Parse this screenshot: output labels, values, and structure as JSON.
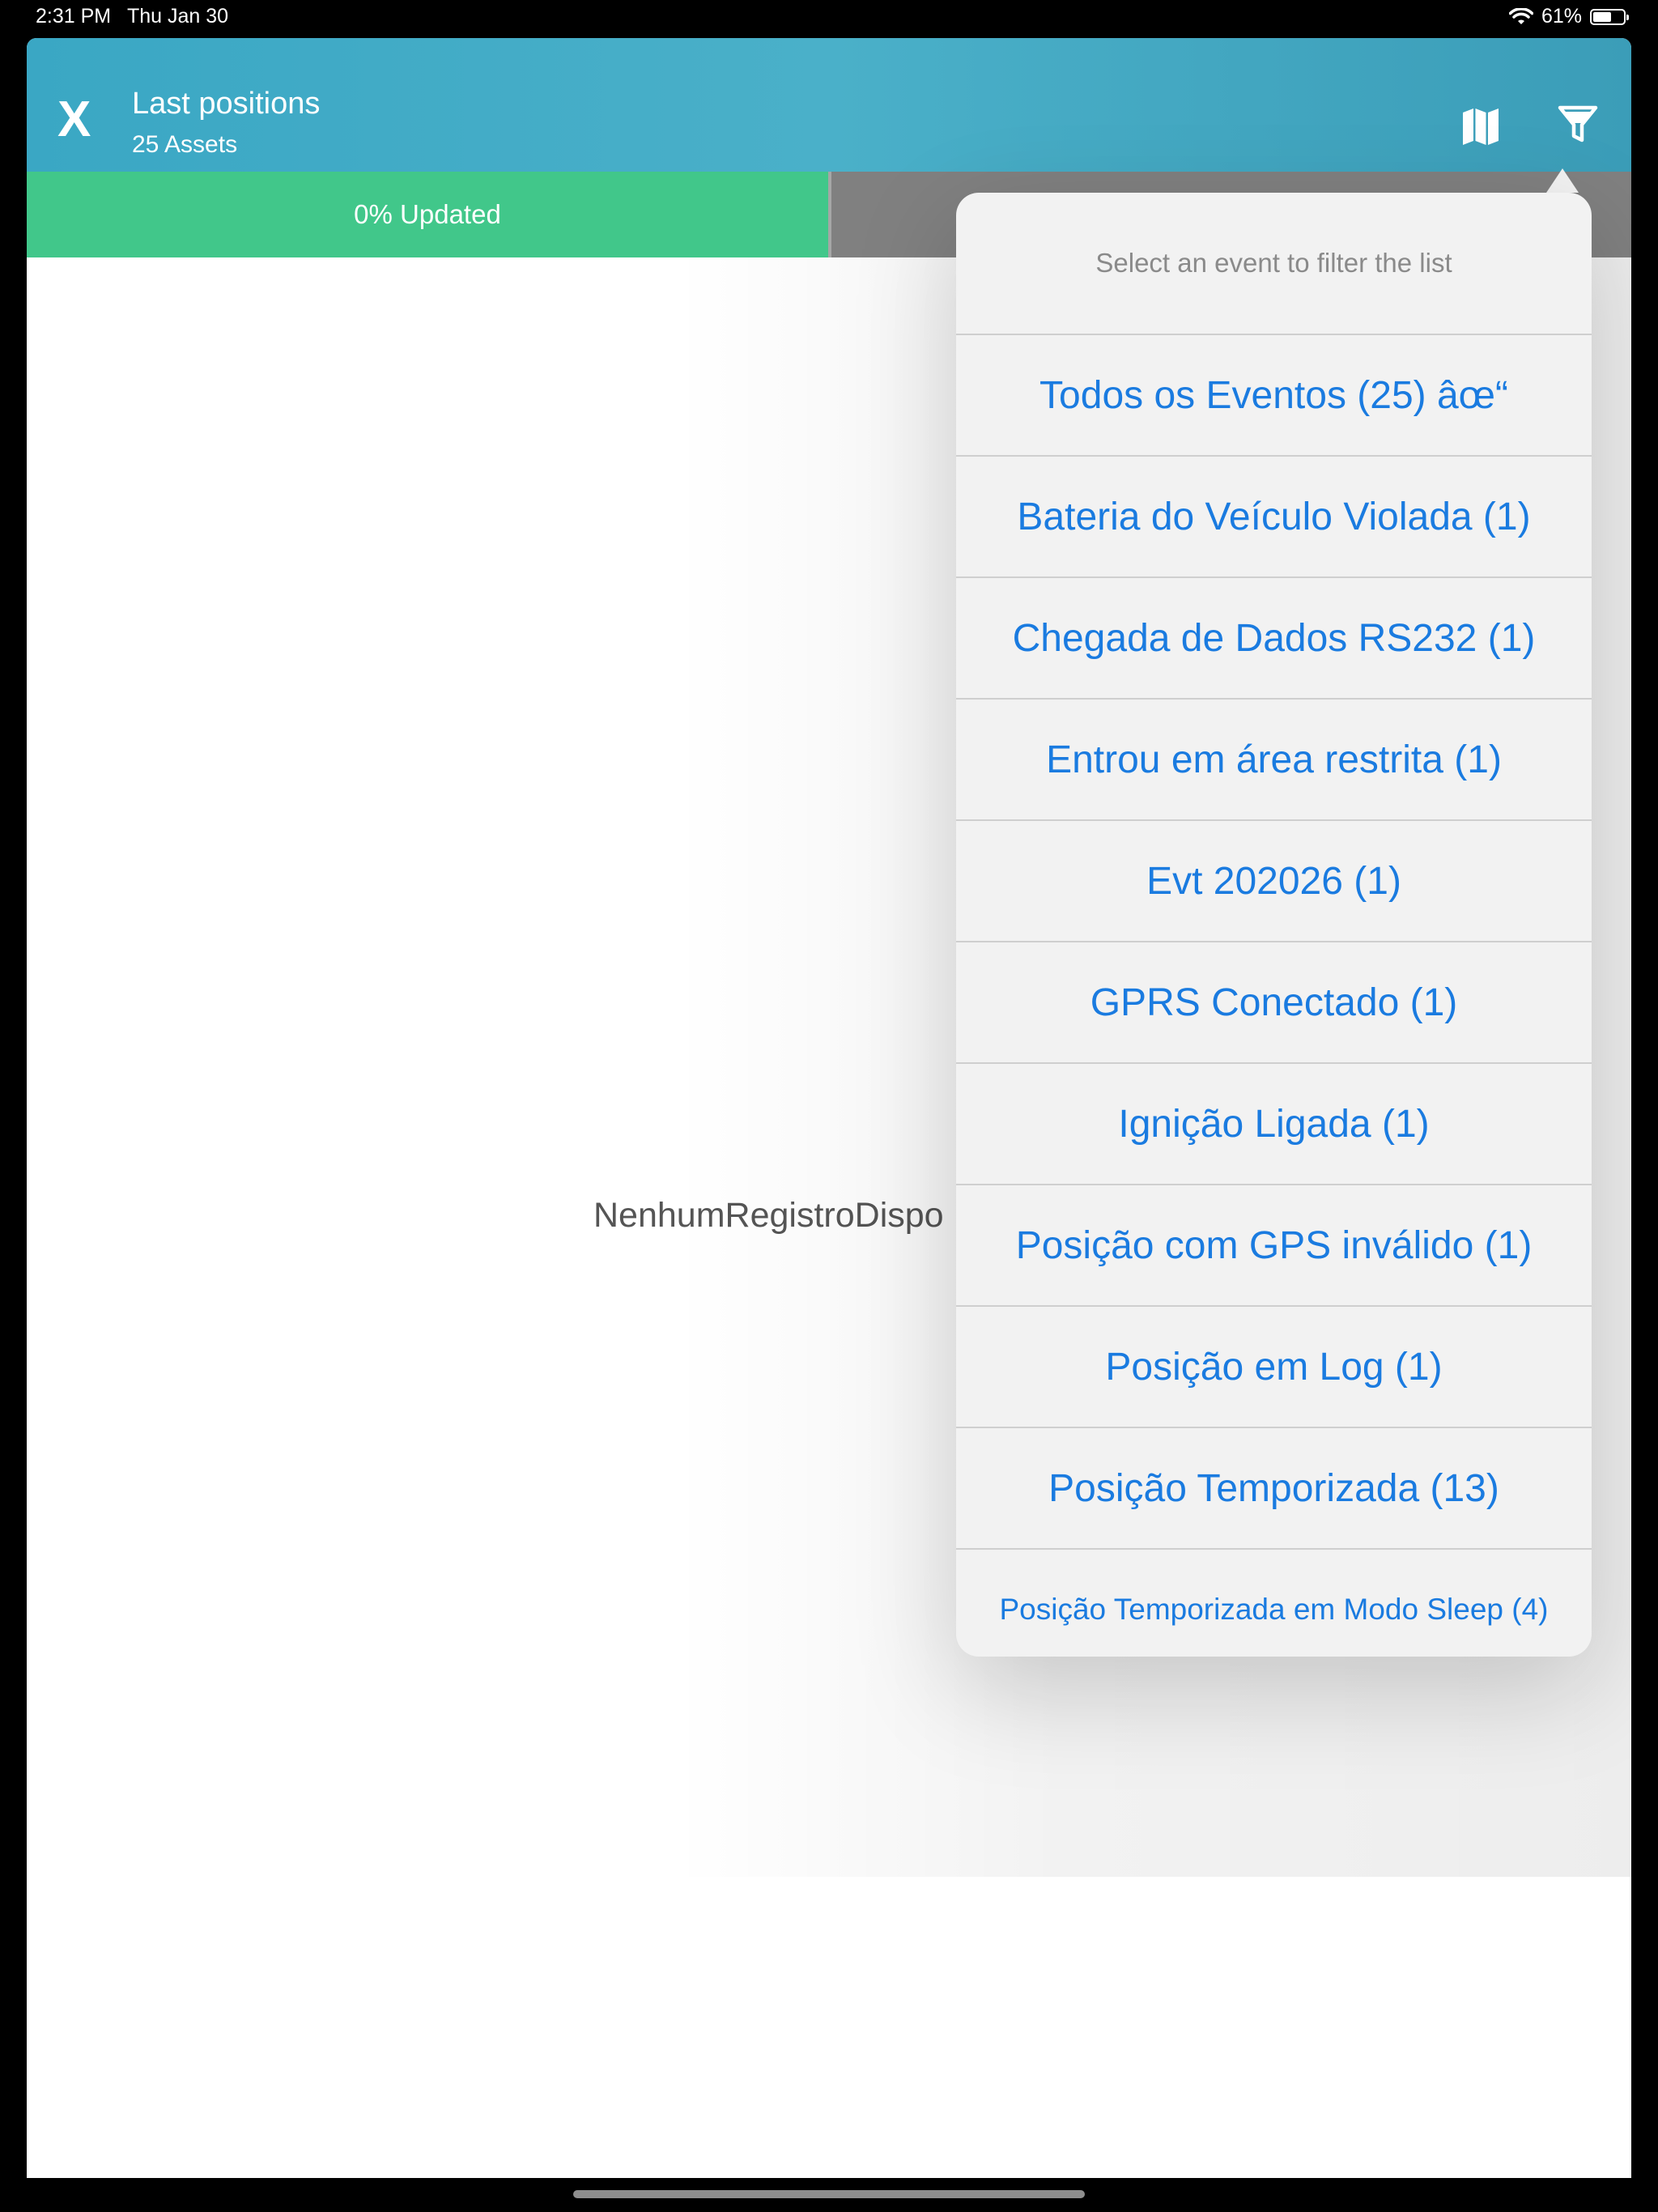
{
  "status_bar": {
    "time": "2:31 PM",
    "date": "Thu Jan 30",
    "battery": "61%"
  },
  "header": {
    "close": "X",
    "title": "Last positions",
    "subtitle": "25 Assets"
  },
  "progress": {
    "label": "0% Updated",
    "percent": 0
  },
  "main": {
    "empty_text": "NenhumRegistroDispo"
  },
  "popover": {
    "header": "Select an event to filter the list",
    "items": [
      {
        "label": "Todos os Eventos (25) âœ“"
      },
      {
        "label": "Bateria do Veículo Violada (1)"
      },
      {
        "label": "Chegada de Dados RS232 (1)"
      },
      {
        "label": "Entrou em área restrita (1)"
      },
      {
        "label": "Evt 202026 (1)"
      },
      {
        "label": "GPRS Conectado (1)"
      },
      {
        "label": "Ignição Ligada (1)"
      },
      {
        "label": "Posição com GPS inválido (1)"
      },
      {
        "label": "Posição em Log (1)"
      },
      {
        "label": "Posição Temporizada (13)"
      },
      {
        "label": "Posição Temporizada em Modo Sleep (4)"
      }
    ]
  },
  "colors": {
    "header": "#3aa7c4",
    "progress_done": "#41c78a",
    "progress_remaining": "#808080",
    "link": "#1a7be0"
  },
  "icons": {
    "map": "map-icon",
    "filter": "filter-icon",
    "wifi": "wifi-icon",
    "battery": "battery-icon"
  }
}
